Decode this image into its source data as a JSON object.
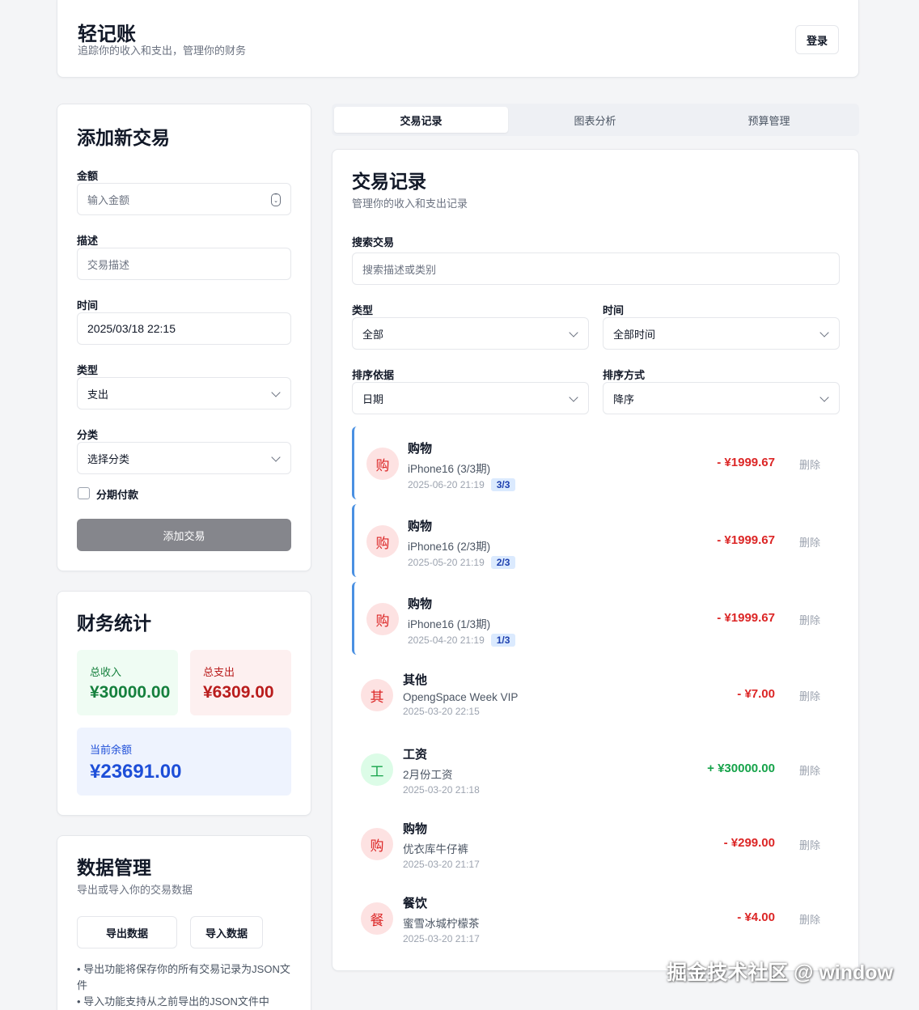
{
  "header": {
    "title": "轻记账",
    "subtitle": "追踪你的收入和支出，管理你的财务",
    "login_label": "登录"
  },
  "add_form": {
    "title": "添加新交易",
    "amount_label": "金额",
    "amount_placeholder": "输入金额",
    "desc_label": "描述",
    "desc_placeholder": "交易描述",
    "time_label": "时间",
    "time_value": "2025/03/18 22:15",
    "type_label": "类型",
    "type_value": "支出",
    "category_label": "分类",
    "category_value": "选择分类",
    "installment_label": "分期付款",
    "installment_checked": false,
    "submit_label": "添加交易"
  },
  "stats": {
    "title": "财务统计",
    "income_label": "总收入",
    "income_value": "¥30000.00",
    "expense_label": "总支出",
    "expense_value": "¥6309.00",
    "balance_label": "当前余额",
    "balance_value": "¥23691.00"
  },
  "data_mgmt": {
    "title": "数据管理",
    "subtitle": "导出或导入你的交易数据",
    "export_label": "导出数据",
    "import_label": "导入数据",
    "note1": "• 导出功能将保存你的所有交易记录为JSON文件",
    "note2": "• 导入功能支持从之前导出的JSON文件中"
  },
  "tabs": [
    {
      "label": "交易记录",
      "active": true
    },
    {
      "label": "图表分析",
      "active": false
    },
    {
      "label": "预算管理",
      "active": false
    }
  ],
  "tx_panel": {
    "title": "交易记录",
    "subtitle": "管理你的收入和支出记录",
    "search_label": "搜索交易",
    "search_placeholder": "搜索描述或类别",
    "type_label": "类型",
    "type_value": "全部",
    "time_label": "时间",
    "time_value": "全部时间",
    "sort_by_label": "排序依据",
    "sort_by_value": "日期",
    "order_label": "排序方式",
    "order_value": "降序",
    "delete_label": "删除"
  },
  "transactions": [
    {
      "icon": "购",
      "category": "购物",
      "desc": "iPhone16 (3/3期)",
      "date": "2025-06-20 21:19",
      "badge": "3/3",
      "amount": "- ¥1999.67",
      "kind": "expense"
    },
    {
      "icon": "购",
      "category": "购物",
      "desc": "iPhone16 (2/3期)",
      "date": "2025-05-20 21:19",
      "badge": "2/3",
      "amount": "- ¥1999.67",
      "kind": "expense"
    },
    {
      "icon": "购",
      "category": "购物",
      "desc": "iPhone16 (1/3期)",
      "date": "2025-04-20 21:19",
      "badge": "1/3",
      "amount": "- ¥1999.67",
      "kind": "expense"
    },
    {
      "icon": "其",
      "category": "其他",
      "desc": "OpengSpace Week VIP",
      "date": "2025-03-20 22:15",
      "badge": "",
      "amount": "- ¥7.00",
      "kind": "expense"
    },
    {
      "icon": "工",
      "category": "工资",
      "desc": "2月份工资",
      "date": "2025-03-20 21:18",
      "badge": "",
      "amount": "+ ¥30000.00",
      "kind": "income"
    },
    {
      "icon": "购",
      "category": "购物",
      "desc": "优衣库牛仔裤",
      "date": "2025-03-20 21:17",
      "badge": "",
      "amount": "- ¥299.00",
      "kind": "expense"
    },
    {
      "icon": "餐",
      "category": "餐饮",
      "desc": "蜜雪冰城柠檬茶",
      "date": "2025-03-20 21:17",
      "badge": "",
      "amount": "- ¥4.00",
      "kind": "expense"
    }
  ],
  "watermark": "掘金技术社区 @ window",
  "colors": {
    "income": "#16a34a",
    "expense": "#dc2626",
    "balance": "#1d4ed8",
    "installment_bar": "#4a90e2",
    "submit_button": "#85868c"
  }
}
